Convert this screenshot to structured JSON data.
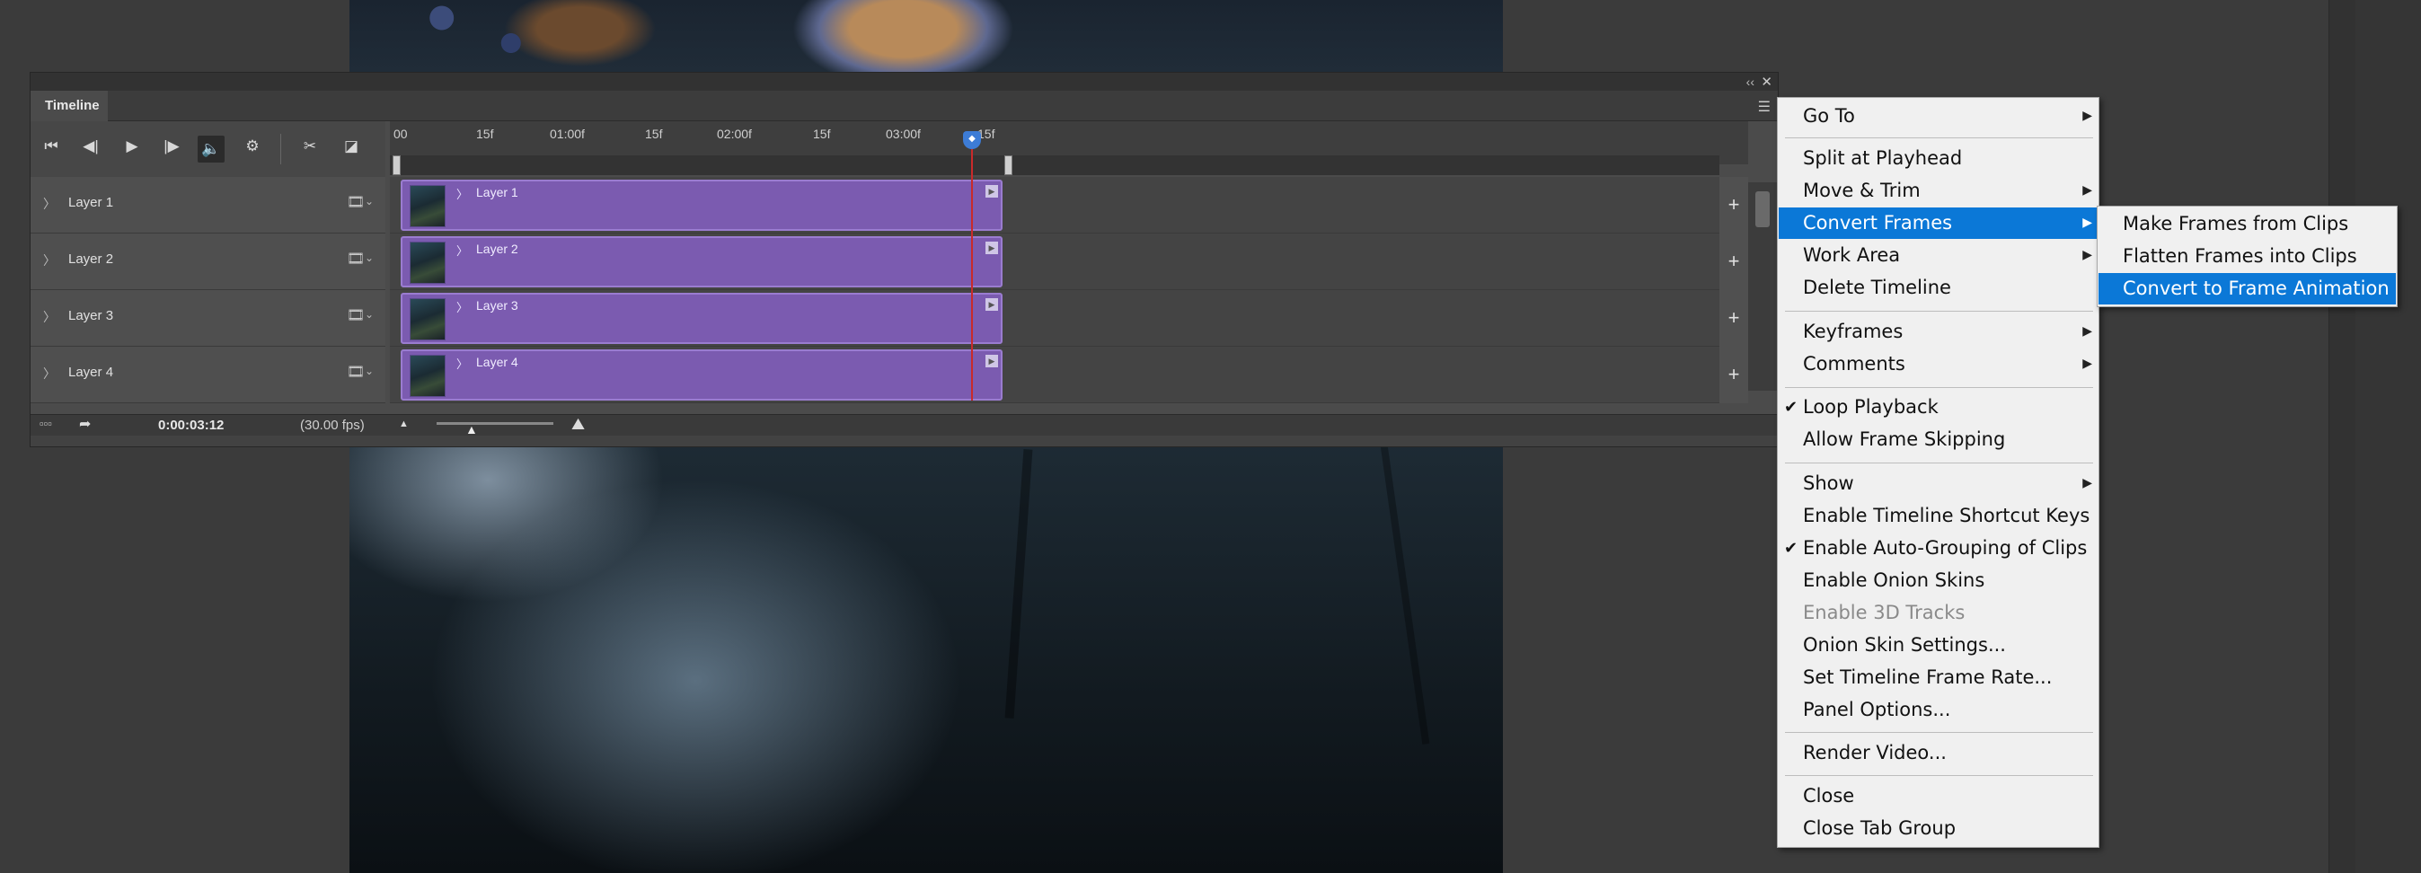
{
  "panel": {
    "tab_label": "Timeline",
    "collapse_icon": "double-chevron-left-icon",
    "close_icon": "close-icon",
    "menu_icon": "hamburger-menu-icon"
  },
  "controls": [
    {
      "name": "go-to-first-frame-icon"
    },
    {
      "name": "go-to-previous-frame-icon"
    },
    {
      "name": "play-icon"
    },
    {
      "name": "go-to-next-frame-icon"
    },
    {
      "name": "audio-icon"
    },
    {
      "name": "settings-gear-icon"
    },
    {
      "name": "split-scissors-icon"
    },
    {
      "name": "transition-icon"
    }
  ],
  "ruler": {
    "ticks": [
      "00",
      "15f",
      "01:00f",
      "15f",
      "02:00f",
      "15f",
      "03:00f",
      "15f"
    ]
  },
  "layers": [
    {
      "name": "Layer 1",
      "clip_label": "Layer 1"
    },
    {
      "name": "Layer 2",
      "clip_label": "Layer 2"
    },
    {
      "name": "Layer 3",
      "clip_label": "Layer 3"
    },
    {
      "name": "Layer 4",
      "clip_label": "Layer 4"
    }
  ],
  "status": {
    "time": "0:00:03:12",
    "fps": "(30.00 fps)"
  },
  "context_menu": {
    "items": [
      {
        "label": "Go To",
        "submenu": true
      },
      {
        "label": "Split at Playhead"
      },
      {
        "label": "Move & Trim",
        "submenu": true
      },
      {
        "label": "Convert Frames",
        "submenu": true,
        "selected": true
      },
      {
        "label": "Work Area",
        "submenu": true
      },
      {
        "label": "Delete Timeline"
      },
      {
        "label": "Keyframes",
        "submenu": true
      },
      {
        "label": "Comments",
        "submenu": true
      },
      {
        "label": "Loop Playback",
        "checked": true
      },
      {
        "label": "Allow Frame Skipping"
      },
      {
        "label": "Show",
        "submenu": true
      },
      {
        "label": "Enable Timeline Shortcut Keys"
      },
      {
        "label": "Enable Auto-Grouping of Clips",
        "checked": true
      },
      {
        "label": "Enable Onion Skins"
      },
      {
        "label": "Enable 3D Tracks",
        "disabled": true
      },
      {
        "label": "Onion Skin Settings..."
      },
      {
        "label": "Set Timeline Frame Rate..."
      },
      {
        "label": "Panel Options..."
      },
      {
        "label": "Render Video..."
      },
      {
        "label": "Close"
      },
      {
        "label": "Close Tab Group"
      }
    ]
  },
  "submenu": {
    "items": [
      {
        "label": "Make Frames from Clips"
      },
      {
        "label": "Flatten Frames into Clips"
      },
      {
        "label": "Convert to Frame Animation",
        "selected": true
      }
    ]
  },
  "colors": {
    "clip_fill": "#7b5bb0",
    "menu_highlight": "#0b78d7",
    "playhead": "#c92a2a"
  }
}
